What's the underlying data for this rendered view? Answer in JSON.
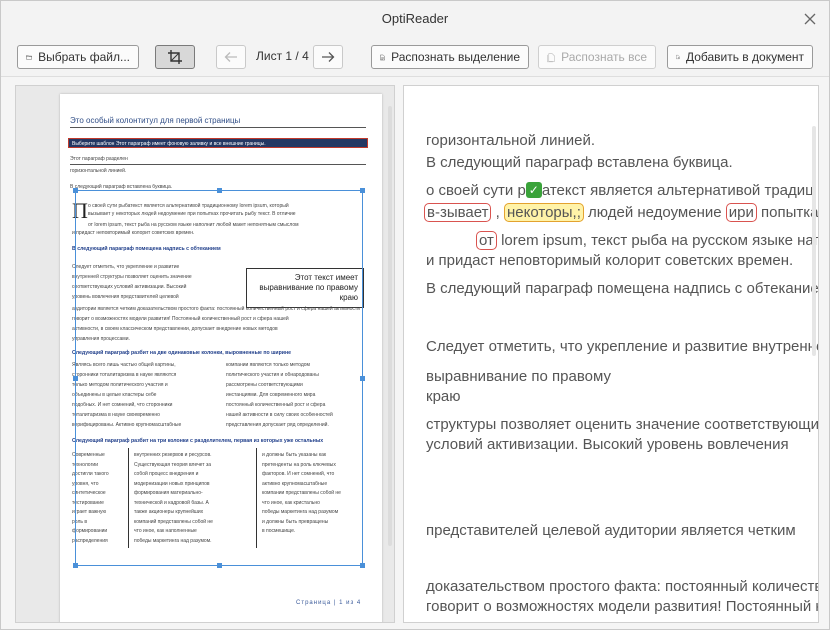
{
  "window": {
    "title": "OptiReader"
  },
  "toolbar": {
    "open_label": "Выбрать файл...",
    "page_label": "Лист 1 / 4",
    "recognize_selection_label": "Распознать выделение",
    "recognize_all_label": "Распознать все",
    "add_to_document_label": "Добавить в документ"
  },
  "document_page": {
    "header": "Это особый колонтитул для первой страницы",
    "banner": "Выберите шаблон       Этот параграф имеет фоновую заливку и все внешние границы.",
    "lines_top": [
      "Этот параграф разделен",
      "горизонтальной линией.",
      "В следующий параграф вставлена буквица."
    ],
    "drop_cap": "П",
    "para1": [
      "о своей сути рыбатекст является альтернативой традиционному lorem ipsum, который",
      "вызывает у некоторых людей недоумение при попытках прочитать рыбу текст. В отличие",
      "от lorem ipsum, текст рыба на русском языке наполнит любой макет непонятным смыслом",
      "и придаст неповторимый колорит советских времен."
    ],
    "heading_wrap": "В следующий параграф помещена надпись с обтеканием",
    "textbox": "Этот текст имеет выравнивание по правому краю",
    "para2": [
      "Следует отметить, что укрепление и развитие",
      "внутренней структуры позволяет оценить значение",
      "соответствующих условий активизации. Высокий",
      "уровень вовлечения представителей целевой",
      "аудитории является четким доказательством простого факта: постоянный количественный рост и сфера нашей активности",
      "говорит о возможностях модели развития! Постоянный количественный рост и сфера нашей",
      "активности, в своем классическом представлении, допускает внедрение новых методов",
      "управления процессами."
    ],
    "heading_two_cols": "Следующий параграф разбит на две одинаковые колонки, выровненные по ширине",
    "two_cols_left": [
      "Являясь всего лишь частью общей картины,",
      "сторонники тоталитаризма в науке являются",
      "только методом политического участия и",
      "объединены в целые кластеры себе",
      "подобных. И нет сомнений, что сторонники",
      "тоталитаризма в науке своевременно",
      "верифицированы. Активно крупномасштабные"
    ],
    "two_cols_right": [
      "компании являются только методом",
      "политического участия и обнародованы",
      "рассмотрены соответствующими",
      "инстанциями. Для современного мира",
      "постоянный количественный рост и сфера",
      "нашей активности в силу своих особенностей",
      "представления допускает ряд определений."
    ],
    "heading_three_cols": "Следующий параграф разбит на три колонки с разделителем, первая из которых уже остальных",
    "three_cols_1": [
      "Современные",
      "технологии",
      "достигли такого",
      "уровня, что",
      "синтетическое",
      "тестирование",
      "играет важную",
      "роль в",
      "формировании",
      "распределения"
    ],
    "three_cols_2": [
      "внутренних резервов и ресурсов.",
      "Существующая теория влечет за",
      "собой процесс внедрения и",
      "модернизации новых принципов",
      "формирования материально-",
      "технической и кадровой базы. А",
      "также акционеры крупнейших",
      "компаний представлены собой не",
      "что иное, как наполненные",
      "победы маркетинга над разумом."
    ],
    "three_cols_3": [
      "и должны быть указаны как",
      "претенденты на роль ключевых",
      "факторов. И нет сомнений, что",
      "активно крупномасштабные",
      "компании представлены собой не",
      "что иное, как кристально",
      "победы маркетинга над разумом",
      "и должны быть превращены",
      "в посмешище."
    ],
    "footer": "Страница | 1 из 4"
  },
  "recognized_text": {
    "line1": "горизонтальной линией.",
    "line2": "В следующий параграф вставлена буквица.",
    "line3_pre": "о своей сути р",
    "line3_post": "атекст является альтернативой традиц",
    "line4_a": "в-зывает",
    "line4_b": ",",
    "line4_c": "некоторы,;",
    "line4_d": "людей недоумение",
    "line4_e": "ири",
    "line4_f": "попытках пр",
    "line5_a": "от",
    "line5_b": "lorem ipsum, текст рыба на русском языке нап",
    "line6": "и придаст неповторимый колорит советских времен.",
    "line7": "В следующий параграф помещена надпись с обтекание",
    "line8": "Следует отметить, что укрепление и развитие внутренне",
    "line9": "выравнивание по правому",
    "line10": "краю",
    "line11": "структуры позволяет оценить значение соответствующи",
    "line12": "условий активизации. Высокий уровень вовлечения",
    "line13": "представителей целевой аудитории является четким",
    "line14": "доказательством простого факта: постоянный количеств",
    "line15": "говорит о возможностях модели развития! Постоянный к"
  }
}
